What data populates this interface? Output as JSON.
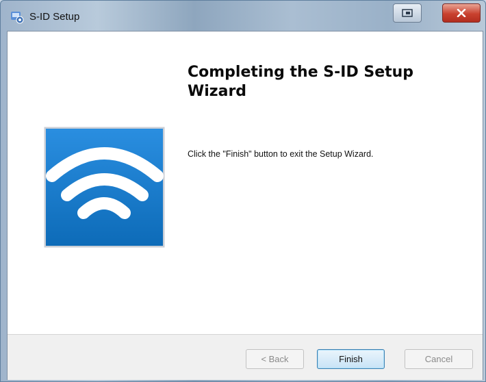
{
  "window": {
    "title": "S-ID Setup",
    "restore_icon": "restore-icon",
    "close_icon": "close-icon"
  },
  "main": {
    "heading": "Completing the S-ID Setup Wizard",
    "message": "Click the \"Finish\" button to exit the Setup Wizard.",
    "logo_icon": "wifi-signal-icon"
  },
  "buttons": {
    "back": "< Back",
    "finish": "Finish",
    "cancel": "Cancel"
  },
  "colors": {
    "logo_blue": "#1e7fd0",
    "accent_button": "#3c7fb1"
  }
}
